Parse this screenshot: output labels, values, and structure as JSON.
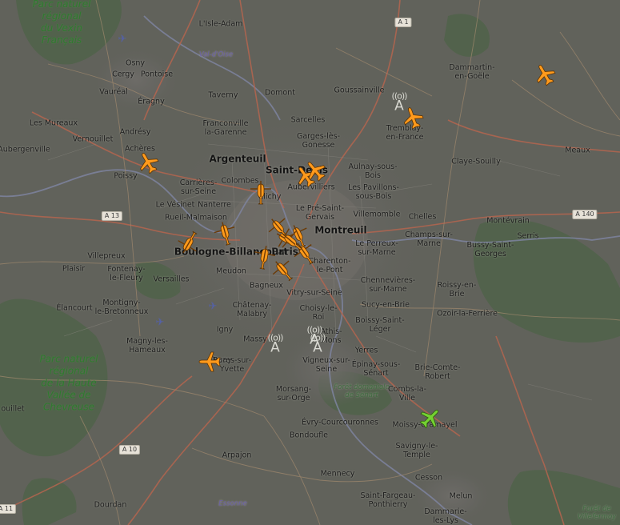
{
  "map": {
    "places": [
      {
        "id": "vexin",
        "label": "Parc naturel\nrégional\ndu Vexin\nFrançais",
        "cls": "park"
      },
      {
        "id": "chevreuse",
        "label": "Parc naturel\nrégional\nde la Haute\nVallée de\nChevreuse",
        "cls": "park"
      },
      {
        "id": "paris",
        "label": "Paris",
        "cls": "big"
      },
      {
        "id": "argenteuil",
        "label": "Argenteuil",
        "cls": "big"
      },
      {
        "id": "saintdenis",
        "label": "Saint-Denis",
        "cls": "big"
      },
      {
        "id": "montreuil",
        "label": "Montreuil",
        "cls": "big"
      },
      {
        "id": "boulogne",
        "label": "Boulogne-Billancourt",
        "cls": "big"
      },
      {
        "id": "lisle",
        "label": "L'Isle-Adam",
        "cls": ""
      },
      {
        "id": "osny",
        "label": "Osny",
        "cls": ""
      },
      {
        "id": "cergy",
        "label": "Cergy",
        "cls": ""
      },
      {
        "id": "pontoise",
        "label": "Pontoise",
        "cls": ""
      },
      {
        "id": "vaureal",
        "label": "Vauréal",
        "cls": ""
      },
      {
        "id": "eragny",
        "label": "Éragny",
        "cls": ""
      },
      {
        "id": "mureaux",
        "label": "Les Mureaux",
        "cls": ""
      },
      {
        "id": "andresy",
        "label": "Andrésy",
        "cls": ""
      },
      {
        "id": "vernouillet",
        "label": "Vernouillet",
        "cls": ""
      },
      {
        "id": "acheres",
        "label": "Achères",
        "cls": ""
      },
      {
        "id": "aubergenville",
        "label": "Aubergenville",
        "cls": ""
      },
      {
        "id": "poissy",
        "label": "Poissy",
        "cls": ""
      },
      {
        "id": "taverny",
        "label": "Taverny",
        "cls": ""
      },
      {
        "id": "domont",
        "label": "Domont",
        "cls": ""
      },
      {
        "id": "goussainville",
        "label": "Goussainville",
        "cls": ""
      },
      {
        "id": "dammartin",
        "label": "Dammartin-\nen-Goële",
        "cls": ""
      },
      {
        "id": "franconville",
        "label": "Franconville\nla-Garenne",
        "cls": ""
      },
      {
        "id": "sarcelles",
        "label": "Sarcelles",
        "cls": ""
      },
      {
        "id": "garges",
        "label": "Garges-lès-\nGonesse",
        "cls": ""
      },
      {
        "id": "tremblay",
        "label": "Tremblay-\nen-France",
        "cls": ""
      },
      {
        "id": "aulnay",
        "label": "Aulnay-sous-\nBois",
        "cls": ""
      },
      {
        "id": "claye",
        "label": "Claye-Souilly",
        "cls": ""
      },
      {
        "id": "meaux",
        "label": "Meaux",
        "cls": ""
      },
      {
        "id": "carrieres",
        "label": "Carrières-\nsur-Seine",
        "cls": ""
      },
      {
        "id": "colombes",
        "label": "Colombes",
        "cls": ""
      },
      {
        "id": "aubervilliers",
        "label": "Aubervilliers",
        "cls": ""
      },
      {
        "id": "pavillons",
        "label": "Les Pavillons-\nsous-Bois",
        "cls": ""
      },
      {
        "id": "clichy",
        "label": "Clichy",
        "cls": ""
      },
      {
        "id": "vesinet",
        "label": "Le Vésinet",
        "cls": ""
      },
      {
        "id": "nanterre",
        "label": "Nanterre",
        "cls": ""
      },
      {
        "id": "preStGervais",
        "label": "Le Pré-Saint-\nGervais",
        "cls": ""
      },
      {
        "id": "villemomble",
        "label": "Villemomble",
        "cls": ""
      },
      {
        "id": "chelles",
        "label": "Chelles",
        "cls": ""
      },
      {
        "id": "montevrain",
        "label": "Montévrain",
        "cls": ""
      },
      {
        "id": "serris",
        "label": "Serris",
        "cls": ""
      },
      {
        "id": "rueil",
        "label": "Rueil-Malmaison",
        "cls": ""
      },
      {
        "id": "champs",
        "label": "Champs-sur-\nMarne",
        "cls": ""
      },
      {
        "id": "bussy",
        "label": "Bussy-Saint-\nGeorges",
        "cls": ""
      },
      {
        "id": "villepreux",
        "label": "Villepreux",
        "cls": ""
      },
      {
        "id": "perreux",
        "label": "Le Perreux-\nsur-Marne",
        "cls": ""
      },
      {
        "id": "plaisir",
        "label": "Plaisir",
        "cls": ""
      },
      {
        "id": "fontenay",
        "label": "Fontenay-\nle-Fleury",
        "cls": ""
      },
      {
        "id": "charenton",
        "label": "Charenton-\nle-Pont",
        "cls": ""
      },
      {
        "id": "meudon",
        "label": "Meudon",
        "cls": ""
      },
      {
        "id": "versailles",
        "label": "Versailles",
        "cls": ""
      },
      {
        "id": "chennevieres",
        "label": "Chennevières-\nsur-Marne",
        "cls": ""
      },
      {
        "id": "roissyb",
        "label": "Roissy-en-\nBrie",
        "cls": ""
      },
      {
        "id": "bagneux",
        "label": "Bagneux",
        "cls": ""
      },
      {
        "id": "elancourt",
        "label": "Élancourt",
        "cls": ""
      },
      {
        "id": "montigny",
        "label": "Montigny-\nle-Bretonneux",
        "cls": ""
      },
      {
        "id": "vitry",
        "label": "Vitry-sur-Seine",
        "cls": ""
      },
      {
        "id": "sucy",
        "label": "Sucy-en-Brie",
        "cls": ""
      },
      {
        "id": "ozoir",
        "label": "Ozoir-la-Ferrière",
        "cls": ""
      },
      {
        "id": "chatenay",
        "label": "Châtenay-\nMalabry",
        "cls": ""
      },
      {
        "id": "choisy",
        "label": "Choisy-le-\nRoi",
        "cls": ""
      },
      {
        "id": "boissy",
        "label": "Boissy-Saint-\nLéger",
        "cls": ""
      },
      {
        "id": "igny",
        "label": "Igny",
        "cls": ""
      },
      {
        "id": "magny",
        "label": "Magny-les-\nHameaux",
        "cls": ""
      },
      {
        "id": "massy",
        "label": "Massy",
        "cls": ""
      },
      {
        "id": "athis",
        "label": "Athis-\nMons",
        "cls": ""
      },
      {
        "id": "yerres",
        "label": "Yerres",
        "cls": ""
      },
      {
        "id": "orsay",
        "label": "Orsay",
        "cls": ""
      },
      {
        "id": "bures",
        "label": "Bures-sur-\nYvette",
        "cls": ""
      },
      {
        "id": "vigneux",
        "label": "Vigneux-sur-\nSeine",
        "cls": ""
      },
      {
        "id": "epinay",
        "label": "Épinay-sous-\nSénart",
        "cls": ""
      },
      {
        "id": "briecomte",
        "label": "Brie-Comte-\nRobert",
        "cls": ""
      },
      {
        "id": "senart",
        "label": "Forêt domaniale\nde Sénart",
        "cls": "forest"
      },
      {
        "id": "combs",
        "label": "Combs-la-\nVille",
        "cls": ""
      },
      {
        "id": "morsang",
        "label": "Morsang-\nsur-Orge",
        "cls": ""
      },
      {
        "id": "bouillet",
        "label": "ouillet",
        "cls": ""
      },
      {
        "id": "evry",
        "label": "Évry-Courcouronnes",
        "cls": ""
      },
      {
        "id": "moissy",
        "label": "Moissy-Cramayel",
        "cls": ""
      },
      {
        "id": "bondoufle",
        "label": "Bondoufle",
        "cls": ""
      },
      {
        "id": "savigny",
        "label": "Savigny-le-\nTemple",
        "cls": ""
      },
      {
        "id": "arpajon",
        "label": "Arpajon",
        "cls": ""
      },
      {
        "id": "mennecy",
        "label": "Mennecy",
        "cls": ""
      },
      {
        "id": "cesson",
        "label": "Cesson",
        "cls": ""
      },
      {
        "id": "stfargeau",
        "label": "Saint-Fargeau-\nPonthierry",
        "cls": ""
      },
      {
        "id": "melun",
        "label": "Melun",
        "cls": ""
      },
      {
        "id": "dourdan",
        "label": "Dourdan",
        "cls": ""
      },
      {
        "id": "dammarie",
        "label": "Dammarie-\nles-Lys",
        "cls": ""
      },
      {
        "id": "villefermoy",
        "label": "Forêt de\nVillefermoy",
        "cls": "forest"
      },
      {
        "id": "valdoise",
        "label": "Val-d'Oise",
        "cls": "water"
      },
      {
        "id": "essonne",
        "label": "Essonne",
        "cls": "water"
      }
    ],
    "shields": [
      {
        "id": "a1",
        "label": "A 1"
      },
      {
        "id": "a13",
        "label": "A 13"
      },
      {
        "id": "a140",
        "label": "A 140"
      },
      {
        "id": "a10",
        "label": "A 10"
      },
      {
        "id": "a11",
        "label": "A 11"
      }
    ],
    "airports": [
      {
        "id": "cdg",
        "ring": "((o))",
        "letter": "A"
      },
      {
        "id": "orly1",
        "ring": "((o))",
        "letter": "A"
      },
      {
        "id": "orly2",
        "ring": "((o))",
        "letter": "A"
      },
      {
        "id": "orly3",
        "ring": "((o))",
        "letter": "A"
      }
    ],
    "aircraft": [
      {
        "id": "ac-dammartin",
        "kind": "fixed",
        "heading": -30
      },
      {
        "id": "ac-cdg",
        "kind": "fixed",
        "heading": -20
      },
      {
        "id": "ac-poissy",
        "kind": "fixed",
        "heading": -30
      },
      {
        "id": "ac-stdenis-1",
        "kind": "fixed",
        "heading": -35
      },
      {
        "id": "ac-stdenis-2",
        "kind": "fixed",
        "heading": -40
      },
      {
        "id": "ac-clichy",
        "kind": "heli",
        "heading": 0
      },
      {
        "id": "ac-boulogne-1",
        "kind": "heli",
        "heading": -150
      },
      {
        "id": "ac-boulogne-2",
        "kind": "heli",
        "heading": -15
      },
      {
        "id": "ac-paris-1",
        "kind": "heli",
        "heading": -40
      },
      {
        "id": "ac-paris-2",
        "kind": "heli",
        "heading": -60
      },
      {
        "id": "ac-paris-3",
        "kind": "heli",
        "heading": -25
      },
      {
        "id": "ac-paris-4",
        "kind": "heli",
        "heading": 10
      },
      {
        "id": "ac-paris-5",
        "kind": "heli",
        "heading": -35
      },
      {
        "id": "ac-paris-6",
        "kind": "heli",
        "heading": -40
      },
      {
        "id": "ac-paris-7",
        "kind": "heli",
        "heading": -50
      },
      {
        "id": "ac-orsay",
        "kind": "fixed",
        "heading": -90
      },
      {
        "id": "ac-moissy",
        "kind": "sel",
        "heading": 45
      }
    ]
  }
}
